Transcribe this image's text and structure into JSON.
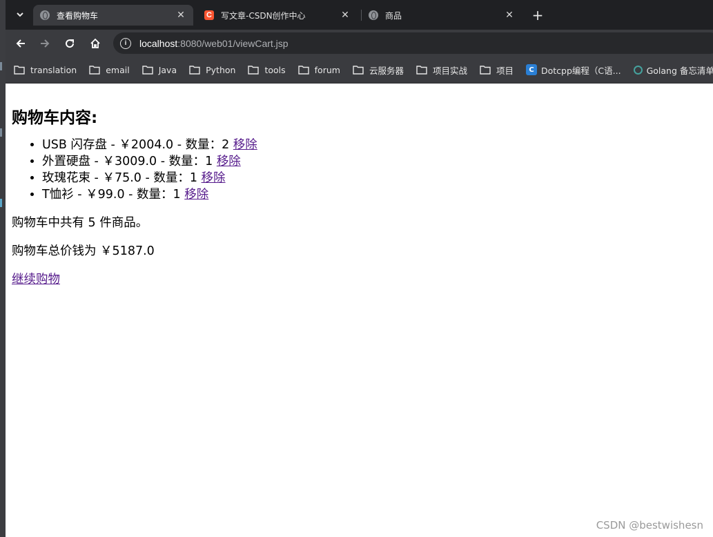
{
  "tabs": [
    {
      "title": "查看购物车",
      "active": true
    },
    {
      "title": "写文章-CSDN创作中心",
      "active": false
    },
    {
      "title": "商品",
      "active": false
    }
  ],
  "toolbar": {
    "url_host": "localhost",
    "url_rest": ":8080/web01/viewCart.jsp"
  },
  "bookmarks": [
    {
      "label": "translation",
      "icon": "folder-icon"
    },
    {
      "label": "email",
      "icon": "folder-icon"
    },
    {
      "label": "Java",
      "icon": "folder-icon"
    },
    {
      "label": "Python",
      "icon": "folder-icon"
    },
    {
      "label": "tools",
      "icon": "folder-icon"
    },
    {
      "label": "forum",
      "icon": "folder-icon"
    },
    {
      "label": "云服务器",
      "icon": "folder-icon"
    },
    {
      "label": "项目实战",
      "icon": "folder-icon"
    },
    {
      "label": "项目",
      "icon": "folder-icon"
    },
    {
      "label": "Dotcpp编程（C语...",
      "icon": "dotcpp-favicon"
    },
    {
      "label": "Golang 备忘清单...",
      "icon": "golang-favicon"
    }
  ],
  "page": {
    "heading": "购物车内容:",
    "items": [
      {
        "text": "USB 闪存盘 - ￥2004.0 - 数量：2 ",
        "link": "移除"
      },
      {
        "text": "外置硬盘 - ￥3009.0 - 数量：1 ",
        "link": "移除"
      },
      {
        "text": "玫瑰花束 - ￥75.0 - 数量：1 ",
        "link": "移除"
      },
      {
        "text": "T恤衫 - ￥99.0 - 数量：1 ",
        "link": "移除"
      }
    ],
    "count_text": "购物车中共有 5 件商品。",
    "total_text": "购物车总价钱为 ￥5187.0",
    "continue_link": "继续购物"
  },
  "watermark": "CSDN @bestwishesn",
  "colors": {
    "tabbar_bg": "#1f2023",
    "toolbar_bg": "#3a3b3f",
    "visited_link": "#551a8b",
    "csdn_brand": "#fc5531"
  }
}
